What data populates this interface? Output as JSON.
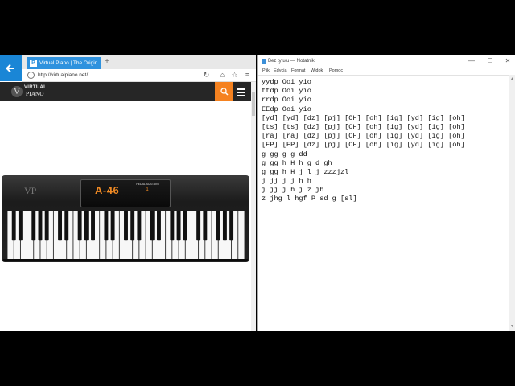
{
  "browser": {
    "tab_title": "Virtual Piano | The Origin...",
    "tab_favicon": "P",
    "new_tab": "+",
    "url": "http://virtualpiano.net/",
    "icons": [
      "back-arrow-icon",
      "favicon-icon",
      "refresh-icon",
      "home-icon",
      "star-icon",
      "menu-icon"
    ]
  },
  "site": {
    "logo_line1": "VIRTUAL",
    "logo_line2": "PIANO",
    "logo_mark": "V",
    "accent": "#f58220"
  },
  "piano": {
    "note": "A-46",
    "sustain_label": "PEDAL SUSTAIN",
    "sustain_value": "1",
    "menu_label": "MENU",
    "logo_mark": "VP",
    "accent": "#f08a24"
  },
  "notepad": {
    "title": "Bez tytułu — Notatnik",
    "controls": [
      "—",
      "☐",
      "✕"
    ],
    "menus": [
      "Plik",
      "Edycja",
      "Format",
      "Widok",
      "Pomoc"
    ],
    "lines": [
      "yydp Ooi yio",
      "ttdp Ooi yio",
      "rrdp Ooi yio",
      "EEdp Ooi yio",
      "[yd] [yd] [dz] [pj] [OH] [oh] [ig] [yd] [ig] [oh]",
      "[ts] [ts] [dz] [pj] [OH] [oh] [ig] [yd] [ig] [oh]",
      "[ra] [ra] [dz] [pj] [OH] [oh] [ig] [yd] [ig] [oh]",
      "[EP] [EP] [dz] [pj] [OH] [oh] [ig] [yd] [ig] [oh]",
      "g gg g g dd",
      "g gg h H h g d gh",
      "g gg h H j l j zzzjzl",
      "j jj j j h h",
      "j jj j h j z jh",
      "z jhg l hgf P sd g [sl]"
    ]
  }
}
